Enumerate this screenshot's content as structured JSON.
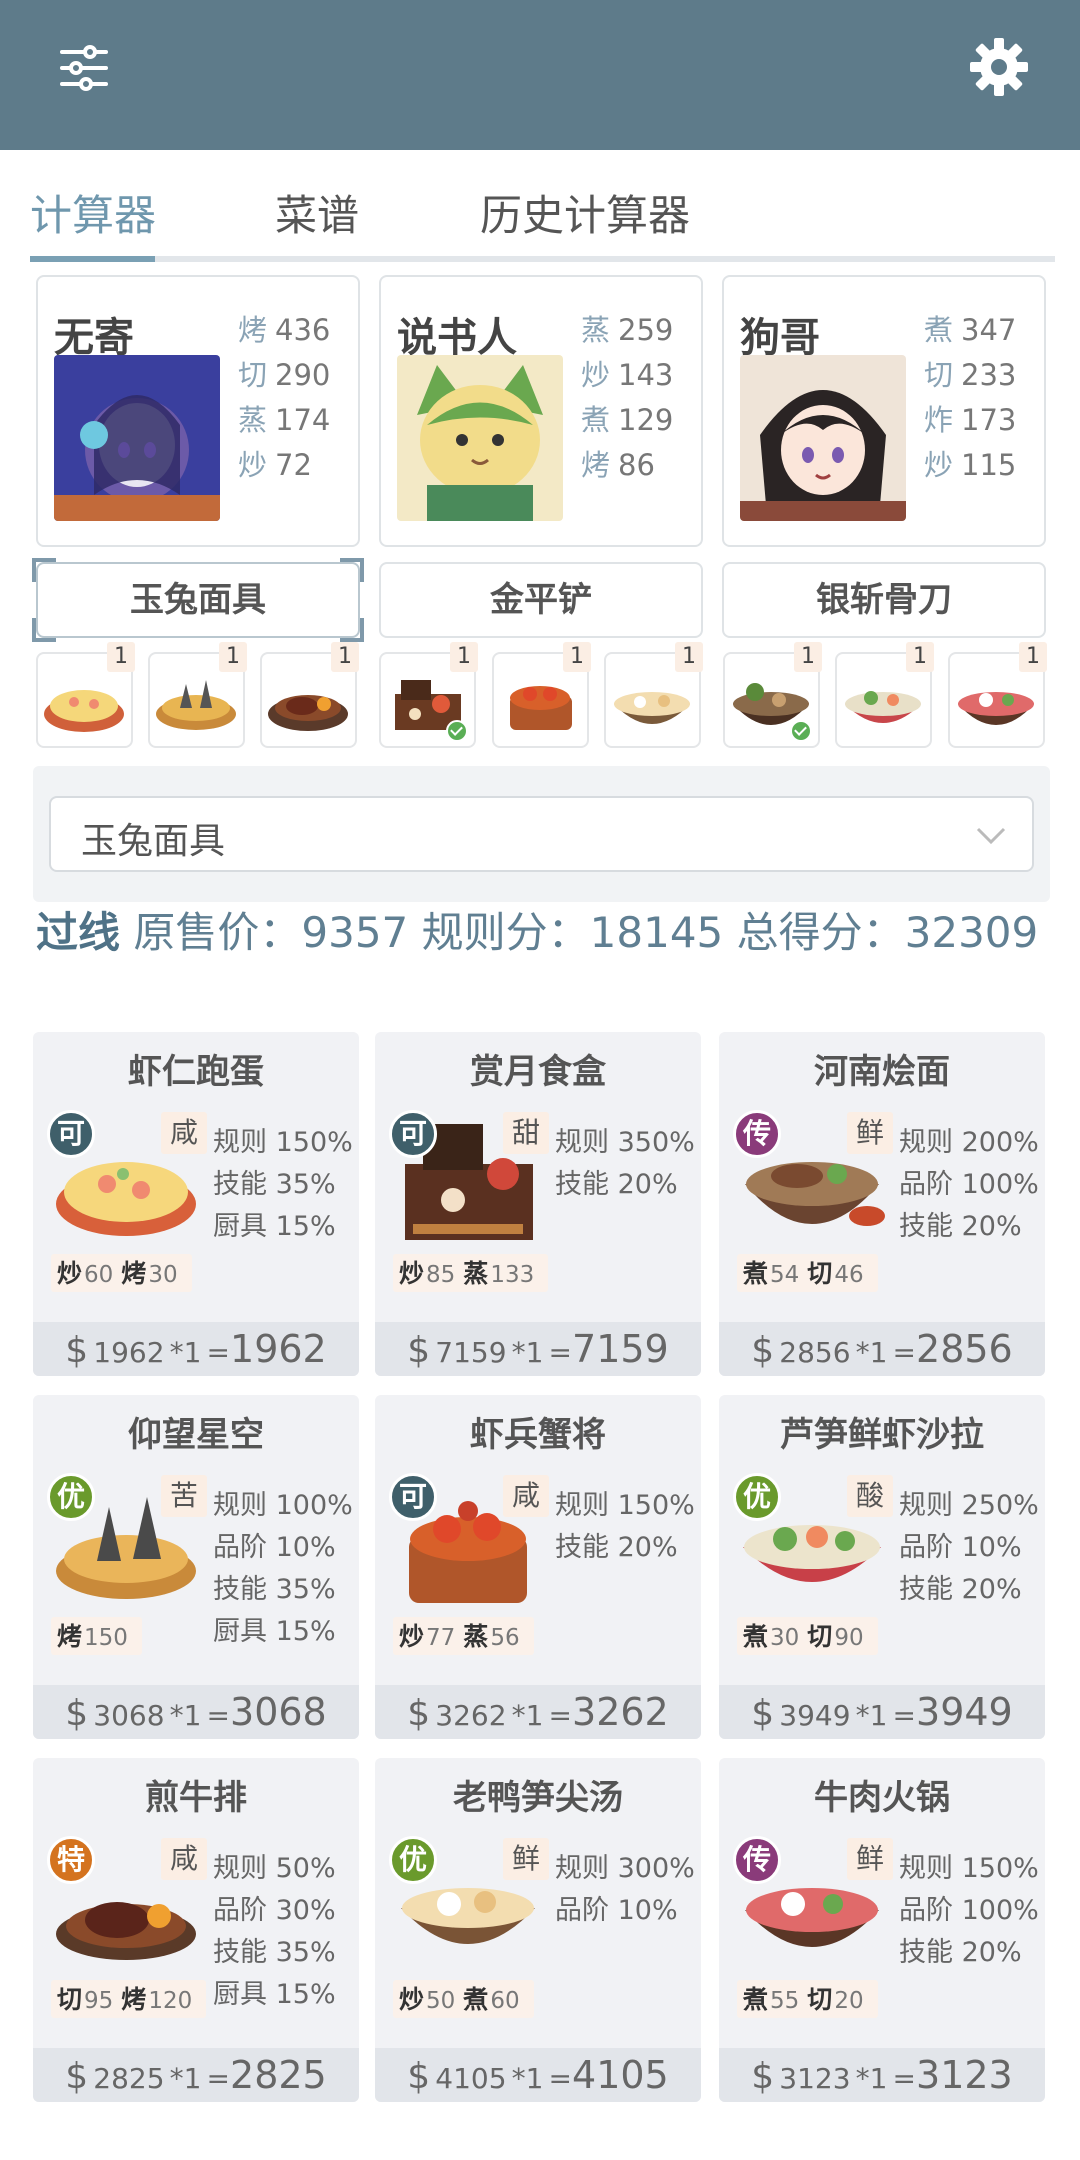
{
  "header": {
    "menu_icon": "sliders-icon",
    "settings_icon": "gear-icon"
  },
  "tabs": [
    {
      "label": "计算器",
      "active": true
    },
    {
      "label": "菜谱",
      "active": false
    },
    {
      "label": "历史计算器",
      "active": false
    }
  ],
  "chefs": [
    {
      "name": "无寄",
      "stats": [
        {
          "skill": "烤",
          "value": "436"
        },
        {
          "skill": "切",
          "value": "290"
        },
        {
          "skill": "蒸",
          "value": "174"
        },
        {
          "skill": "炒",
          "value": "72"
        }
      ]
    },
    {
      "name": "说书人",
      "stats": [
        {
          "skill": "蒸",
          "value": "259"
        },
        {
          "skill": "炒",
          "value": "143"
        },
        {
          "skill": "煮",
          "value": "129"
        },
        {
          "skill": "烤",
          "value": "86"
        }
      ]
    },
    {
      "name": "狗哥",
      "stats": [
        {
          "skill": "煮",
          "value": "347"
        },
        {
          "skill": "切",
          "value": "233"
        },
        {
          "skill": "炸",
          "value": "173"
        },
        {
          "skill": "炒",
          "value": "115"
        }
      ]
    }
  ],
  "equipment": [
    "玉兔面具",
    "金平铲",
    "银斩骨刀"
  ],
  "recipe_slots": [
    {
      "count": "1",
      "checked": false
    },
    {
      "count": "1",
      "checked": false
    },
    {
      "count": "1",
      "checked": false
    },
    {
      "count": "1",
      "checked": true
    },
    {
      "count": "1",
      "checked": false
    },
    {
      "count": "1",
      "checked": false
    },
    {
      "count": "1",
      "checked": true
    },
    {
      "count": "1",
      "checked": false
    },
    {
      "count": "1",
      "checked": false
    }
  ],
  "selector": {
    "value": "玉兔面具"
  },
  "summary": {
    "status": "过线",
    "original_label": "原售价：",
    "original": "9357",
    "rule_label": "规则分：",
    "rule": "18145",
    "total_label": "总得分：",
    "total": "32309"
  },
  "dishes": [
    {
      "name": "虾仁跑蛋",
      "grade": "可",
      "grade_color": "#3f5f6a",
      "flavor": "咸",
      "bonus": [
        "规则 150%",
        "技能 35%",
        "厨具 15%"
      ],
      "skills": [
        {
          "k": "炒",
          "v": "60"
        },
        {
          "k": "烤",
          "v": "30"
        }
      ],
      "price_unit": "1962",
      "price_mult": "*1",
      "price_eq": "=",
      "price_total": "1962"
    },
    {
      "name": "赏月食盒",
      "grade": "可",
      "grade_color": "#3f5f6a",
      "flavor": "甜",
      "bonus": [
        "规则 350%",
        "技能 20%"
      ],
      "skills": [
        {
          "k": "炒",
          "v": "85"
        },
        {
          "k": "蒸",
          "v": "133"
        }
      ],
      "price_unit": "7159",
      "price_mult": "*1",
      "price_eq": "=",
      "price_total": "7159"
    },
    {
      "name": "河南烩面",
      "grade": "传",
      "grade_color": "#8a3b7a",
      "flavor": "鲜",
      "bonus": [
        "规则 200%",
        "品阶 100%",
        "技能 20%"
      ],
      "skills": [
        {
          "k": "煮",
          "v": "54"
        },
        {
          "k": "切",
          "v": "46"
        }
      ],
      "price_unit": "2856",
      "price_mult": "*1",
      "price_eq": "=",
      "price_total": "2856"
    },
    {
      "name": "仰望星空",
      "grade": "优",
      "grade_color": "#6a9a2c",
      "flavor": "苦",
      "bonus": [
        "规则 100%",
        "品阶 10%",
        "技能 35%",
        "厨具 15%"
      ],
      "skills": [
        {
          "k": "烤",
          "v": "150"
        }
      ],
      "price_unit": "3068",
      "price_mult": "*1",
      "price_eq": "=",
      "price_total": "3068"
    },
    {
      "name": "虾兵蟹将",
      "grade": "可",
      "grade_color": "#3f5f6a",
      "flavor": "咸",
      "bonus": [
        "规则 150%",
        "技能 20%"
      ],
      "skills": [
        {
          "k": "炒",
          "v": "77"
        },
        {
          "k": "蒸",
          "v": "56"
        }
      ],
      "price_unit": "3262",
      "price_mult": "*1",
      "price_eq": "=",
      "price_total": "3262"
    },
    {
      "name": "芦笋鲜虾沙拉",
      "grade": "优",
      "grade_color": "#6a9a2c",
      "flavor": "酸",
      "bonus": [
        "规则 250%",
        "品阶 10%",
        "技能 20%"
      ],
      "skills": [
        {
          "k": "煮",
          "v": "30"
        },
        {
          "k": "切",
          "v": "90"
        }
      ],
      "price_unit": "3949",
      "price_mult": "*1",
      "price_eq": "=",
      "price_total": "3949"
    },
    {
      "name": "煎牛排",
      "grade": "特",
      "grade_color": "#d4731f",
      "flavor": "咸",
      "bonus": [
        "规则 50%",
        "品阶 30%",
        "技能 35%",
        "厨具 15%"
      ],
      "skills": [
        {
          "k": "切",
          "v": "95"
        },
        {
          "k": "烤",
          "v": "120"
        }
      ],
      "price_unit": "2825",
      "price_mult": "*1",
      "price_eq": "=",
      "price_total": "2825"
    },
    {
      "name": "老鸭笋尖汤",
      "grade": "优",
      "grade_color": "#6a9a2c",
      "flavor": "鲜",
      "bonus": [
        "规则 300%",
        "品阶 10%"
      ],
      "skills": [
        {
          "k": "炒",
          "v": "50"
        },
        {
          "k": "煮",
          "v": "60"
        }
      ],
      "price_unit": "4105",
      "price_mult": "*1",
      "price_eq": "=",
      "price_total": "4105"
    },
    {
      "name": "牛肉火锅",
      "grade": "传",
      "grade_color": "#8a3b7a",
      "flavor": "鲜",
      "bonus": [
        "规则 150%",
        "品阶 100%",
        "技能 20%"
      ],
      "skills": [
        {
          "k": "煮",
          "v": "55"
        },
        {
          "k": "切",
          "v": "20"
        }
      ],
      "price_unit": "3123",
      "price_mult": "*1",
      "price_eq": "=",
      "price_total": "3123"
    }
  ],
  "currency_symbol": "$"
}
